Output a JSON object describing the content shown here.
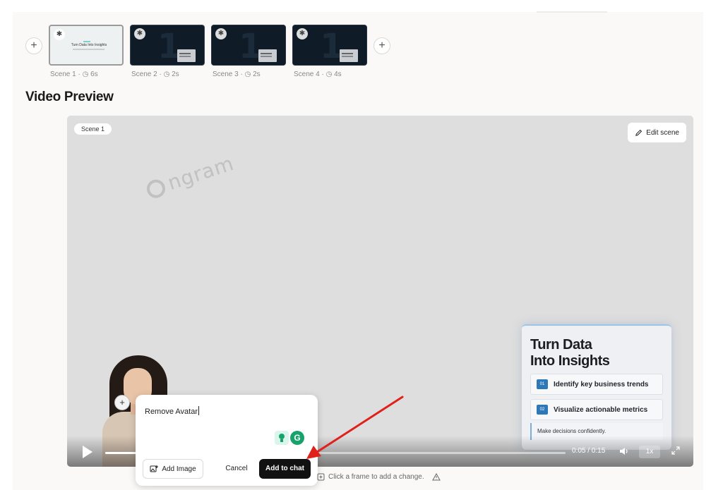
{
  "scenes": [
    {
      "label": "Scene 1 · ◷ 6s",
      "thumb_title": "Turn Data Into Insights"
    },
    {
      "label": "Scene 2 · ◷ 2s"
    },
    {
      "label": "Scene 3 · ◷ 2s"
    },
    {
      "label": "Scene 4 · ◷ 4s"
    }
  ],
  "add_scene_symbol": "+",
  "section_title": "Video Preview",
  "video": {
    "scene_chip": "Scene 1",
    "edit_label": "Edit scene",
    "watermark": "ngram",
    "avatar_plus": "+",
    "card": {
      "title_line1": "Turn Data",
      "title_line2": "Into Insights",
      "items": [
        {
          "num": "01",
          "text": "Identify key business trends"
        },
        {
          "num": "02",
          "text": "Visualize actionable metrics"
        }
      ],
      "footer": "Make decisions confidently."
    },
    "controls": {
      "progress_fraction": 0.33,
      "time": "0:05 / 0:15",
      "speed": "1x"
    }
  },
  "chat_popup": {
    "input_value": "Remove Avatar",
    "g_letter": "G",
    "add_image_label": "Add Image",
    "cancel_label": "Cancel",
    "submit_label": "Add to chat"
  },
  "hint_text": "Click a frame to add a change.",
  "colors": {
    "annotation_arrow": "#e0201b",
    "primary_button": "#111111",
    "card_accent": "#2f78b8"
  }
}
